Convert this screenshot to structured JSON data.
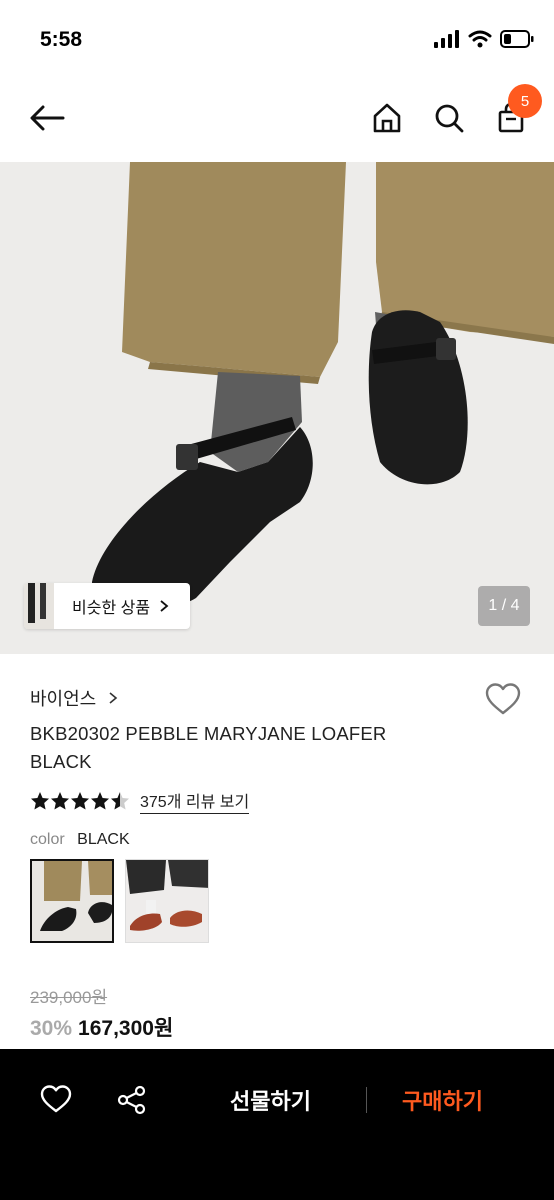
{
  "status": {
    "time": "5:58"
  },
  "nav": {
    "cart_count": "5",
    "icons": [
      "back-arrow-icon",
      "home-icon",
      "search-icon",
      "shopping-bag-icon"
    ]
  },
  "gallery": {
    "similar_label": "비슷한 상품",
    "page_indicator": "1 / 4"
  },
  "product": {
    "brand": "바이언스",
    "name": "BKB20302 PEBBLE MARYJANE LOAFER BLACK",
    "rating": 4.5,
    "review_link": "375개 리뷰 보기",
    "color_label": "color",
    "color_value": "BLACK",
    "original_price": "239,000원",
    "discount": "30%",
    "sale_price": "167,300원"
  },
  "bottom": {
    "gift_label": "선물하기",
    "buy_label": "구매하기"
  },
  "colors": {
    "accent": "#ff5a1f",
    "buy": "#ff5a1f",
    "bar_bg": "#000000"
  }
}
